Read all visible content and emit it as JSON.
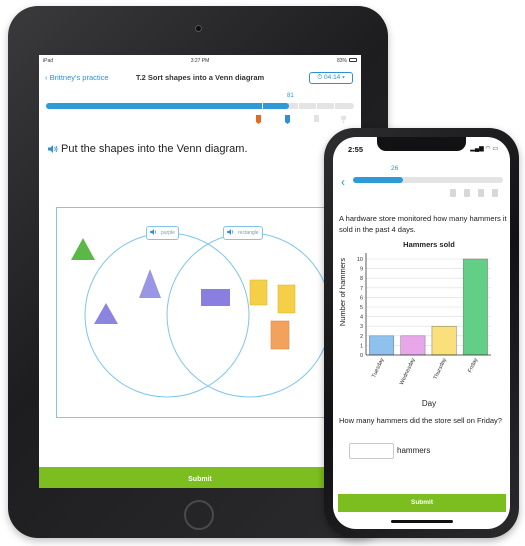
{
  "tablet": {
    "status": {
      "carrier": "iPad",
      "time": "3:27 PM",
      "battery": "83%"
    },
    "nav": {
      "back_label": "Brittney's practice",
      "title": "T.2 Sort shapes into a Venn diagram",
      "timer": "04:14"
    },
    "progress": {
      "value": 81,
      "fraction": 0.79
    },
    "question": "Put the shapes into the Venn diagram.",
    "venn": {
      "left_label": "purple",
      "right_label": "rectangle",
      "shapes": [
        {
          "kind": "triangle",
          "color": "#5bb847",
          "region": "outside"
        },
        {
          "kind": "triangle",
          "color": "#9b95e6",
          "region": "purple"
        },
        {
          "kind": "triangle",
          "color": "#8b85e0",
          "region": "purple"
        },
        {
          "kind": "rectangle",
          "color": "#8a7ee0",
          "region": "both"
        },
        {
          "kind": "rectangle",
          "color": "#f4cf47",
          "region": "rectangle"
        },
        {
          "kind": "rectangle",
          "color": "#f4cf47",
          "region": "rectangle"
        },
        {
          "kind": "rectangle",
          "color": "#f2a25c",
          "region": "rectangle"
        }
      ]
    },
    "submit_label": "Submit"
  },
  "phone": {
    "status": {
      "time": "2:55"
    },
    "progress": {
      "value": 26,
      "fraction": 0.33
    },
    "question": "A hardware store monitored how many hammers it sold in the past 4 days.",
    "chart_data": {
      "type": "bar",
      "title": "Hammers sold",
      "xlabel": "Day",
      "ylabel": "Number of hammers",
      "categories": [
        "Tuesday",
        "Wednesday",
        "Thursday",
        "Friday"
      ],
      "values": [
        2,
        2,
        3,
        10
      ],
      "colors": [
        "#8ec1ee",
        "#e8a7e8",
        "#f9e07a",
        "#63cf86"
      ],
      "ylim": [
        0,
        10
      ],
      "yticks": [
        0,
        1,
        2,
        3,
        4,
        5,
        6,
        7,
        8,
        9,
        10
      ],
      "grid": true
    },
    "question2": "How many hammers did the store sell on Friday?",
    "answer": {
      "value": "",
      "unit": "hammers"
    },
    "submit_label": "Submit"
  },
  "colors": {
    "accent": "#2e8fd6",
    "submit": "#7cbd1f"
  }
}
